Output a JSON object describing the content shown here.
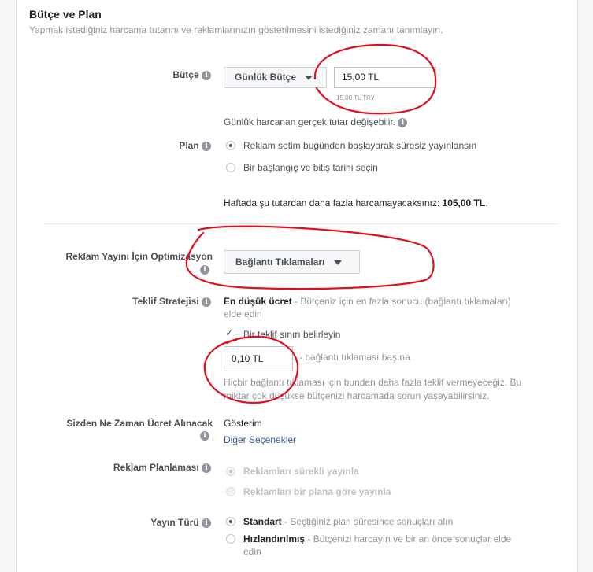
{
  "header": {
    "title": "Bütçe ve Plan",
    "subtitle": "Yapmak istediğiniz harcama tutarını ve reklamlarınızın gösterilmesini istediğiniz zamanı tanımlayın."
  },
  "budget": {
    "label": "Bütçe",
    "type_label": "Günlük Bütçe",
    "amount": "15,00 TL",
    "amount_note": "15,00 TL TRY",
    "hint": "Günlük harcanan gerçek tutar değişebilir."
  },
  "plan": {
    "label": "Plan",
    "option_1": "Reklam setim bugünden başlayarak süresiz yayınlansın",
    "option_2": "Bir başlangıç ve bitiş tarihi seçin",
    "weekly_note": "Haftada şu tutardan daha fazla harcamayacaksınız:",
    "weekly_amount": "105,00 TL",
    "weekly_end": "."
  },
  "optimization": {
    "label": "Reklam Yayını İçin Optimizasyon",
    "value": "Bağlantı Tıklamaları"
  },
  "bid": {
    "label": "Teklif Stratejisi",
    "strategy_bold": "En düşük ücret",
    "strategy_rest": " - Bütçeniz için en fazla sonucu (bağlantı tıklamaları)",
    "strategy_line2": "elde edin",
    "limit_checkbox": "Bir teklif sınırı belirleyin",
    "limit_value": "0,10 TL",
    "limit_suffix": "- bağlantı tıklaması başına",
    "limit_note_1": "Hiçbir bağlantı tıklaması için bundan daha fazla teklif vermeyeceğiz. Bu",
    "limit_note_2": "miktar çok düşükse bütçenizi harcamada sorun yaşayabilirsiniz."
  },
  "charge": {
    "label": "Sizden Ne Zaman Ücret Alınacak",
    "value": "Gösterim",
    "more": "Diğer Seçenekler"
  },
  "scheduling": {
    "label": "Reklam Planlaması",
    "option_1": "Reklamları sürekli yayınla",
    "option_2": "Reklamları bir plana göre yayınla"
  },
  "delivery": {
    "label": "Yayın Türü",
    "option_1_bold": "Standart",
    "option_1_rest": " - Seçtiğiniz plan süresince sonuçları alın",
    "option_2_bold": "Hızlandırılmış",
    "option_2_rest": " - Bütçenizi harcayın ve bir an önce sonuçlar elde",
    "option_2_line2": "edin"
  },
  "colors": {
    "annotation_red": "#e0101e",
    "link_blue": "#365899"
  }
}
